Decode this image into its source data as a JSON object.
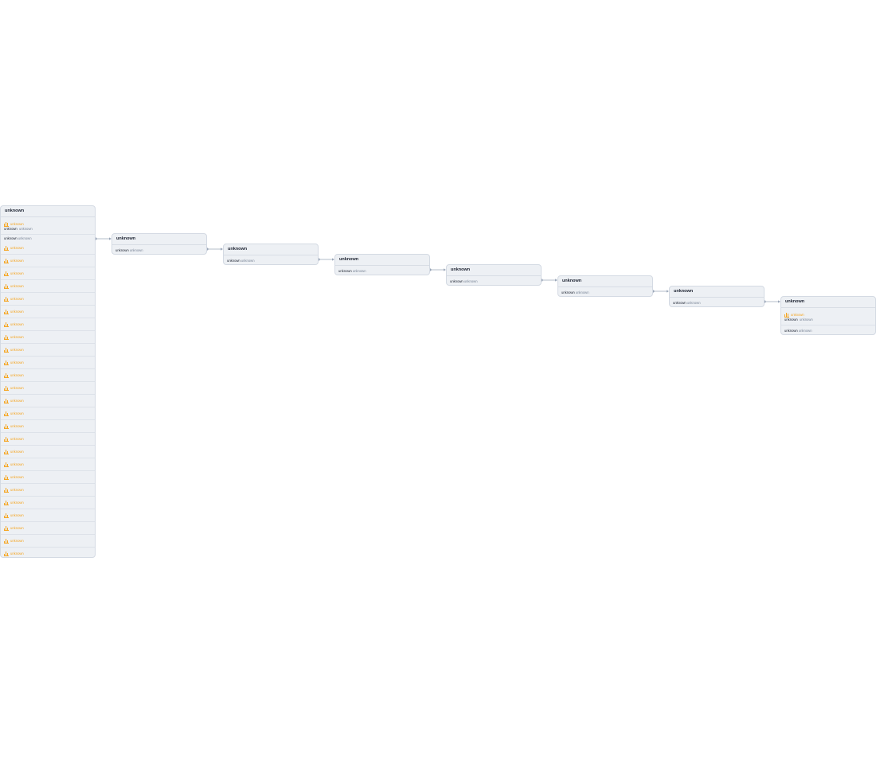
{
  "colors": {
    "node_bg": "#edf0f4",
    "node_border": "#d4dae3",
    "title_text": "#1c2230",
    "alert": "#f5a623",
    "muted_text": "#7a8597",
    "edge": "#9aa6b8"
  },
  "icons": {
    "alert": "bar-chart-icon",
    "edge_start": "connector-dot-icon",
    "edge_end": "arrowhead-icon"
  },
  "nodes": [
    {
      "title": "unknown",
      "first_alert": {
        "label": "unknown",
        "key": "unknown",
        "value": "unknown"
      },
      "field": {
        "key": "unknown",
        "value": "unknown"
      },
      "alerts": [
        "unknown",
        "unknown",
        "unknown",
        "unknown",
        "unknown",
        "unknown",
        "unknown",
        "unknown",
        "unknown",
        "unknown",
        "unknown",
        "unknown",
        "unknown",
        "unknown",
        "unknown",
        "unknown",
        "unknown",
        "unknown",
        "unknown",
        "unknown",
        "unknown",
        "unknown",
        "unknown",
        "unknown",
        "unknown",
        "unknown"
      ]
    },
    {
      "title": "unknown",
      "field": {
        "key": "unknown",
        "value": "unknown"
      }
    },
    {
      "title": "unknown",
      "field": {
        "key": "unknown",
        "value": "unknown"
      }
    },
    {
      "title": "unknown",
      "field": {
        "key": "unknown",
        "value": "unknown"
      }
    },
    {
      "title": "unknown",
      "field": {
        "key": "unknown",
        "value": "unknown"
      }
    },
    {
      "title": "unknown",
      "field": {
        "key": "unknown",
        "value": "unknown"
      }
    },
    {
      "title": "unknown",
      "field": {
        "key": "unknown",
        "value": "unknown"
      }
    },
    {
      "title": "unknown",
      "first_alert": {
        "label": "unknown",
        "key": "unknown",
        "value": "unknown"
      },
      "field": {
        "key": "unknown",
        "value": "unknown"
      }
    }
  ]
}
